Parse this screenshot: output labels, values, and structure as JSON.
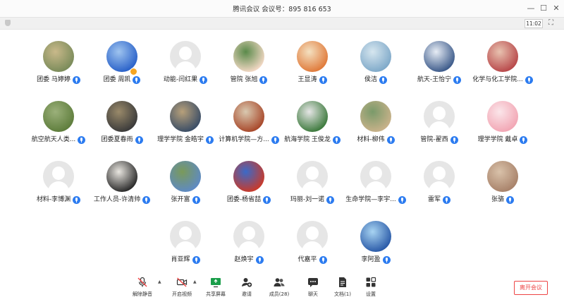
{
  "window": {
    "title": "腾讯会议 会议号：895 816 653",
    "minimize": "—",
    "maximize": "☐",
    "close": "✕"
  },
  "topbar": {
    "time": "11:02",
    "fullscreen": "⛶"
  },
  "participants": [
    {
      "name": "团委 马婷婷",
      "avatar": "photo",
      "c1": "#7a8b5a",
      "c2": "#c9b98a"
    },
    {
      "name": "团委 周凯",
      "avatar": "photo",
      "c1": "#2a62c9",
      "c2": "#9fc4ef",
      "host_badge": true
    },
    {
      "name": "动能-闫红果",
      "avatar": "default"
    },
    {
      "name": "管院 张旭",
      "avatar": "photo",
      "c1": "#f2d8c4",
      "c2": "#5a8a4a"
    },
    {
      "name": "王显涛",
      "avatar": "photo",
      "c1": "#e07a3a",
      "c2": "#f4e1c1"
    },
    {
      "name": "侯洁",
      "avatar": "photo",
      "c1": "#7fa9c9",
      "c2": "#d6e6ef"
    },
    {
      "name": "航天-王怡宁",
      "avatar": "photo",
      "c1": "#3c5a8a",
      "c2": "#e7edf5"
    },
    {
      "name": "化学与化工学院...",
      "avatar": "photo",
      "c1": "#b8484a",
      "c2": "#e8c2b0"
    },
    {
      "name": "航空航天人类...",
      "avatar": "photo",
      "c1": "#5e7d3c",
      "c2": "#9bb07a"
    },
    {
      "name": "团委夏春雨",
      "avatar": "photo",
      "c1": "#3a3a3a",
      "c2": "#9a8a6a"
    },
    {
      "name": "理学学院 金皓宇",
      "avatar": "photo",
      "c1": "#3a4d66",
      "c2": "#b7a07a"
    },
    {
      "name": "计算机学院—方...",
      "avatar": "photo",
      "c1": "#a8482a",
      "c2": "#d9c9b0"
    },
    {
      "name": "航海学院 王俊龙",
      "avatar": "photo",
      "c1": "#3d7a3d",
      "c2": "#e6e6e6"
    },
    {
      "name": "材料-柳伟",
      "avatar": "photo",
      "c1": "#c9b28a",
      "c2": "#7a9a6a"
    },
    {
      "name": "管院-翟西",
      "avatar": "default"
    },
    {
      "name": "理学学院 戴卓",
      "avatar": "photo",
      "c1": "#f2a6b4",
      "c2": "#fbe6ea"
    },
    {
      "name": "材料-李博渊",
      "avatar": "default"
    },
    {
      "name": "工作人员-许清帅",
      "avatar": "photo",
      "c1": "#2a2a2a",
      "c2": "#e9e6e0"
    },
    {
      "name": "张开富",
      "avatar": "photo",
      "c1": "#5e8ac4",
      "c2": "#7a9a5a"
    },
    {
      "name": "团委-杨省喆",
      "avatar": "photo",
      "c1": "#c93a2a",
      "c2": "#3a6ac9"
    },
    {
      "name": "玛丽-刘一诺",
      "avatar": "default"
    },
    {
      "name": "生命学院—李宇...",
      "avatar": "default"
    },
    {
      "name": "雷军",
      "avatar": "default"
    },
    {
      "name": "张骆",
      "avatar": "photo",
      "c1": "#a8826a",
      "c2": "#d9c2aa"
    },
    {
      "name": "肖亚辉",
      "avatar": "default"
    },
    {
      "name": "赵焕宇",
      "avatar": "default"
    },
    {
      "name": "代嘉平",
      "avatar": "default"
    },
    {
      "name": "李阿盈",
      "avatar": "photo",
      "c1": "#2a5aa8",
      "c2": "#a8d4f2"
    }
  ],
  "toolbar": {
    "items": [
      {
        "label": "解除静音",
        "name": "unmute-button",
        "icon": "mic-off-icon"
      },
      {
        "label": "开启视频",
        "name": "start-video-button",
        "icon": "camera-off-icon"
      },
      {
        "label": "共享屏幕",
        "name": "share-screen-button",
        "icon": "share-screen-icon"
      },
      {
        "label": "邀请",
        "name": "invite-button",
        "icon": "add-person-icon"
      },
      {
        "label": "成员(28)",
        "name": "members-button",
        "icon": "members-icon"
      },
      {
        "label": "聊天",
        "name": "chat-button",
        "icon": "chat-icon"
      },
      {
        "label": "文档(1)",
        "name": "document-button",
        "icon": "document-icon"
      },
      {
        "label": "设置",
        "name": "settings-button",
        "icon": "settings-icon"
      }
    ],
    "caret": "▲",
    "leave_label": "离开会议"
  },
  "colors": {
    "mic_blue": "#2d7cf0",
    "leave_red": "#e44444",
    "share_green": "#1a9e4a"
  }
}
